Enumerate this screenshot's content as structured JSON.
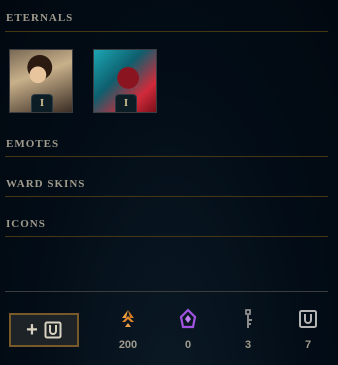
{
  "sections": {
    "eternals": "ETERNALS",
    "emotes": "EMOTES",
    "ward_skins": "WARD SKINS",
    "icons": "ICONS"
  },
  "eternals": [
    {
      "badge": "I",
      "icon": "champion-portrait"
    },
    {
      "badge": "I",
      "icon": "champion-portrait"
    }
  ],
  "add_button": {
    "label": "+",
    "icon": "loot-chest-icon"
  },
  "currencies": [
    {
      "name": "orange-essence",
      "icon": "orange-essence-icon",
      "value": "200",
      "color": "#e48a2a"
    },
    {
      "name": "mythic-essence",
      "icon": "mythic-essence-icon",
      "value": "0",
      "color": "#a052e0"
    },
    {
      "name": "keys",
      "icon": "key-icon",
      "value": "3",
      "color": "#8c8c8c"
    },
    {
      "name": "chests",
      "icon": "chest-icon",
      "value": "7",
      "color": "#b4b4b4"
    }
  ]
}
